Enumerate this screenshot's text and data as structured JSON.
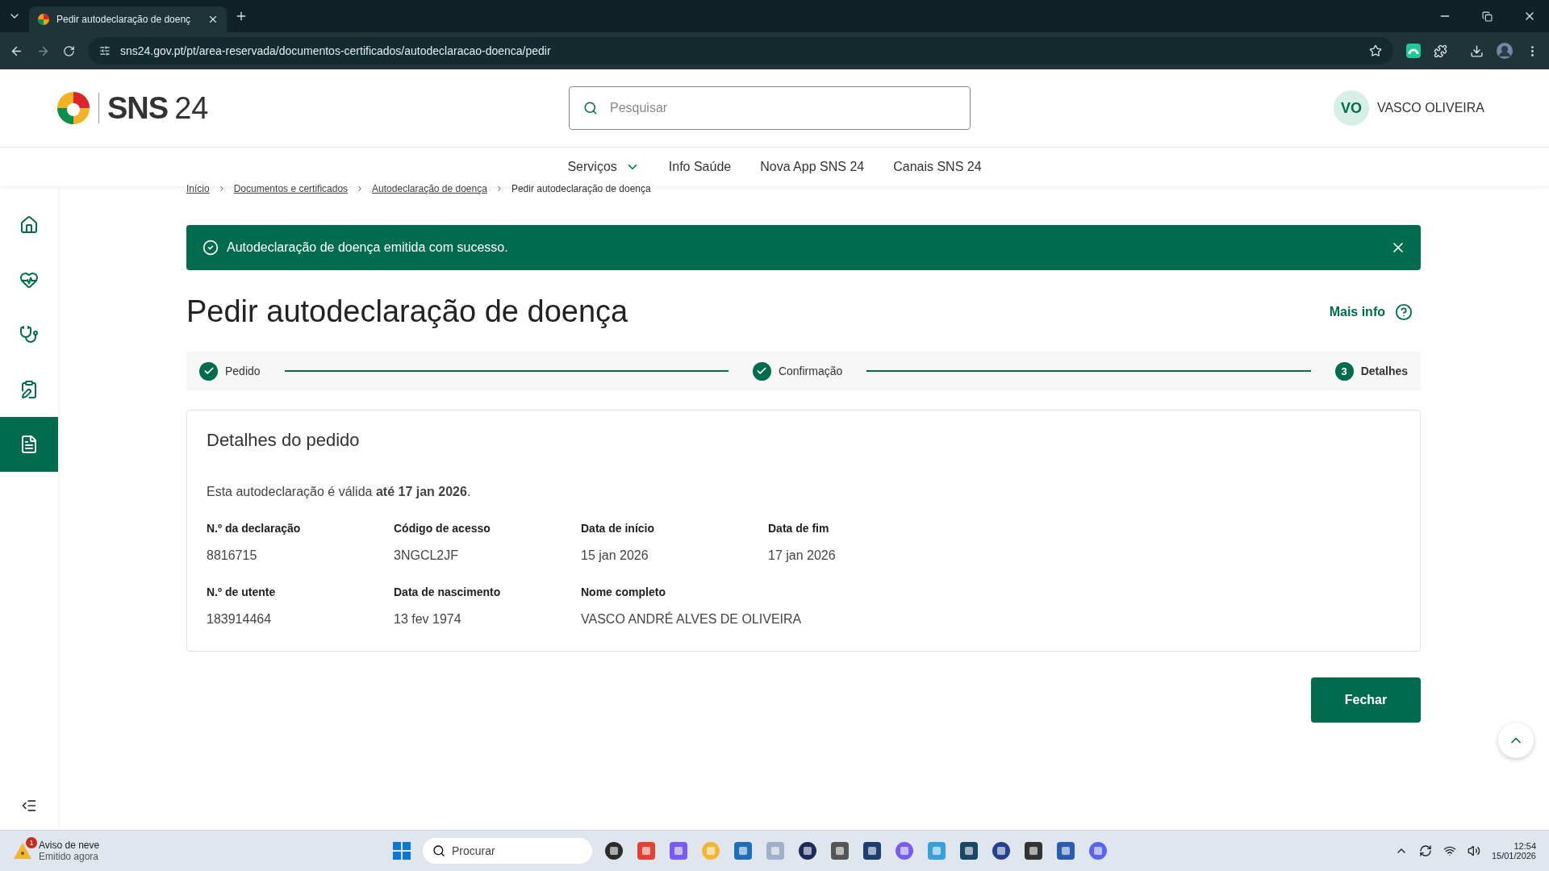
{
  "browser": {
    "tab_title": "Pedir autodeclaração de doenç",
    "url": "sns24.gov.pt/pt/area-reservada/documentos-certificados/autodeclaracao-doenca/pedir"
  },
  "header": {
    "logo_name": "SNS",
    "logo_number": "24",
    "search_placeholder": "Pesquisar",
    "user_initials": "VO",
    "user_name": "VASCO OLIVEIRA"
  },
  "nav": [
    {
      "label": "Serviços",
      "has_menu": true
    },
    {
      "label": "Info Saúde",
      "has_menu": false
    },
    {
      "label": "Nova App SNS 24",
      "has_menu": false
    },
    {
      "label": "Canais SNS 24",
      "has_menu": false
    }
  ],
  "breadcrumb": [
    "Início",
    "Documentos e certificados",
    "Autodeclaração de doença",
    "Pedir autodeclaração de doença"
  ],
  "sidebar": [
    {
      "kind": "home",
      "selected": false
    },
    {
      "kind": "health",
      "selected": false
    },
    {
      "kind": "doctor",
      "selected": false
    },
    {
      "kind": "clipboard",
      "selected": false
    },
    {
      "kind": "document",
      "selected": true
    }
  ],
  "alert": {
    "message": "Autodeclaração de doença emitida com sucesso."
  },
  "title": "Pedir autodeclaração de doença",
  "more_info": "Mais info",
  "steps": [
    {
      "label": "Pedido",
      "done": true
    },
    {
      "label": "Confirmação",
      "done": true
    },
    {
      "label": "Detalhes",
      "done": false,
      "number": "3"
    }
  ],
  "card": {
    "title": "Detalhes do pedido",
    "validity": "Esta autodeclaração é válida **até 17 jan 2026**.",
    "rows": [
      [
        {
          "label": "N.º da declaração",
          "value": "8816715"
        },
        {
          "label": "Código de acesso",
          "value": "3NGCL2JF"
        },
        {
          "label": "Data de início",
          "value": "15 jan 2026"
        },
        {
          "label": "Data de fim",
          "value": "17 jan 2026"
        }
      ],
      [
        {
          "label": "N.º de utente",
          "value": "183914464"
        },
        {
          "label": "Data de nascimento",
          "value": "13 fev 1974"
        },
        {
          "label": "Nome completo",
          "value": "VASCO ANDRÉ ALVES DE OLIVEIRA"
        }
      ]
    ]
  },
  "close_button": "Fechar",
  "taskbar": {
    "weather_title": "Aviso de neve",
    "weather_subtitle": "Emitido agora",
    "weather_badge": "1",
    "search_placeholder": "Procurar",
    "time": "12:54",
    "date": "15/01/2026"
  }
}
